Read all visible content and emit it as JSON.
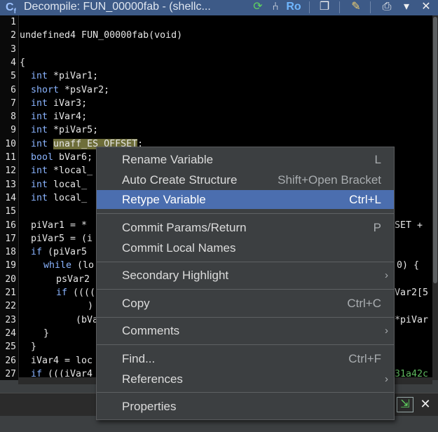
{
  "window": {
    "title": "Decompile: FUN_00000fab -  (shellc...",
    "ro_label": "Ro"
  },
  "line_numbers": [
    "1",
    "2",
    "3",
    "4",
    "5",
    "6",
    "7",
    "8",
    "9",
    "10",
    "11",
    "12",
    "13",
    "14",
    "15",
    "16",
    "17",
    "18",
    "19",
    "20",
    "21",
    "22",
    "23",
    "24",
    "25",
    "26",
    "27"
  ],
  "code": {
    "l2": "undefined4 FUN_00000fab(void)",
    "l4": "{",
    "l5": [
      "int",
      " *piVar1;"
    ],
    "l6": [
      "short",
      " *psVar2;"
    ],
    "l7": [
      "int",
      " iVar3;"
    ],
    "l8": [
      "int",
      " iVar4;"
    ],
    "l9": [
      "int",
      " *piVar5;"
    ],
    "l10": [
      "int",
      " ",
      "unaff_ES_OFFSET",
      ";"
    ],
    "l11": [
      "bool",
      " bVar6;"
    ],
    "l12": [
      "int",
      " *local_"
    ],
    "l13": [
      "int",
      " local_"
    ],
    "l14": [
      "int",
      " local_"
    ],
    "l16": "piVar1 = *",
    "l16r": "SET +",
    "l17": "piVar5 = (i",
    "l18": [
      "if",
      " (piVar5"
    ],
    "l19": [
      "while",
      " (lo"
    ],
    "l19r": "0) {",
    "l20": "psVar2",
    "l21": [
      "if",
      " (((("
    ],
    "l21r": "Var2[5",
    "l22": ")",
    "l23": "(bVa",
    "l23r": "*piVar",
    "l24": "}",
    "l25": "}",
    "l26": "iVar4 = loc",
    "l27": [
      "if",
      " (((iVar4"
    ],
    "l27r": "31a42c"
  },
  "context_menu": {
    "items": [
      {
        "label": "Rename Variable",
        "shortcut": "L"
      },
      {
        "label": "Auto Create Structure",
        "shortcut": "Shift+Open Bracket"
      },
      {
        "label": "Retype Variable",
        "shortcut": "Ctrl+L"
      },
      {
        "label": "Commit Params/Return",
        "shortcut": "P"
      },
      {
        "label": "Commit Local Names",
        "shortcut": ""
      },
      {
        "label": "Secondary Highlight",
        "shortcut": ""
      },
      {
        "label": "Copy",
        "shortcut": "Ctrl+C"
      },
      {
        "label": "Comments",
        "shortcut": ""
      },
      {
        "label": "Find...",
        "shortcut": "Ctrl+F"
      },
      {
        "label": "References",
        "shortcut": ""
      },
      {
        "label": "Properties",
        "shortcut": ""
      }
    ]
  },
  "colors": {
    "title_bar": "#3d5a87",
    "editor_bg": "#000000",
    "keyword": "#8ab4ff",
    "menu_bg": "#3c3f41",
    "menu_selected": "#4b6eaf",
    "highlight": "#6e6e3a"
  }
}
